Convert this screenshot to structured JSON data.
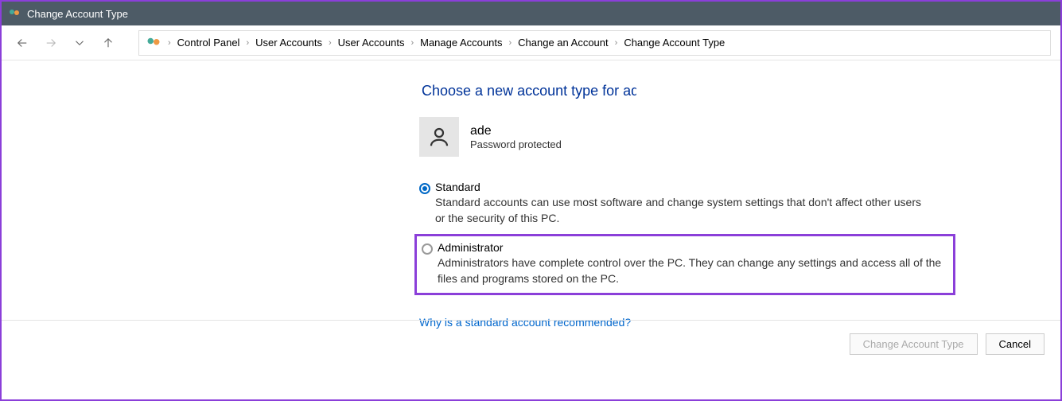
{
  "window": {
    "title": "Change Account Type"
  },
  "breadcrumb": {
    "items": [
      {
        "label": "Control Panel"
      },
      {
        "label": "User Accounts"
      },
      {
        "label": "User Accounts"
      },
      {
        "label": "Manage Accounts"
      },
      {
        "label": "Change an Account"
      },
      {
        "label": "Change Account Type"
      }
    ]
  },
  "heading": "Choose a new account type for ade",
  "account": {
    "name": "ade",
    "status": "Password protected"
  },
  "options": {
    "standard": {
      "title": "Standard",
      "desc": "Standard accounts can use most software and change system settings that don't affect other users or the security of this PC."
    },
    "admin": {
      "title": "Administrator",
      "desc": "Administrators have complete control over the PC. They can change any settings and access all of the files and programs stored on the PC."
    }
  },
  "link": "Why is a standard account recommended?",
  "buttons": {
    "change": "Change Account Type",
    "cancel": "Cancel"
  }
}
